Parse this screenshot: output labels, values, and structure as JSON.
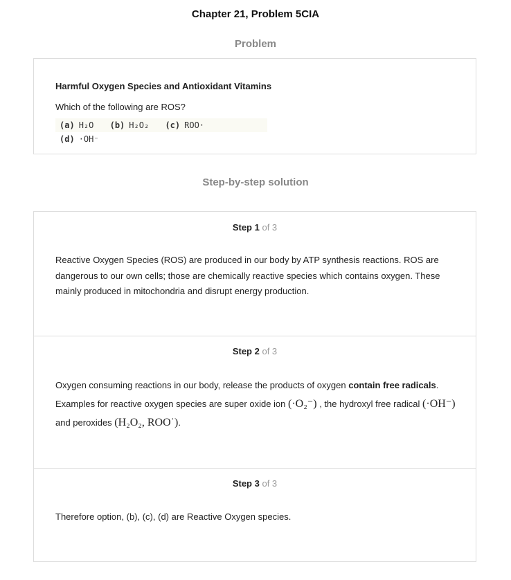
{
  "title": "Chapter 21, Problem 5CIA",
  "problem_heading": "Problem",
  "problem": {
    "heading": "Harmful Oxygen Species and Antioxidant Vitamins",
    "question": "Which of the following are ROS?",
    "options": [
      {
        "label": "(a)",
        "value": "H₂O"
      },
      {
        "label": "(b)",
        "value": "H₂O₂"
      },
      {
        "label": "(c)",
        "value": "ROO·"
      },
      {
        "label": "(d)",
        "value": "·OH⁻"
      }
    ]
  },
  "solution_heading": "Step-by-step solution",
  "steps": [
    {
      "label": "Step 1",
      "of": "of 3",
      "text": "Reactive Oxygen Species (ROS) are produced in our body by ATP synthesis reactions. ROS are dangerous to our own cells; those are chemically reactive species which contains oxygen. These mainly produced in mitochondria and disrupt energy production."
    },
    {
      "label": "Step 2",
      "of": "of 3",
      "t1": "Oxygen consuming reactions in our body, release the products of oxygen ",
      "b1": "contain free radicals",
      "t2": ". Examples for reactive oxygen species are super oxide ion ",
      "m1": "(·O₂⁻)",
      "t3": " , the hydroxyl free radical ",
      "m2": "(·OH⁻)",
      "t4": " and peroxides ",
      "m3": "(H₂O₂, ROO˙)",
      "t5": "."
    },
    {
      "label": "Step 3",
      "of": "of 3",
      "text": "Therefore option, (b), (c), (d) are Reactive Oxygen species."
    }
  ]
}
